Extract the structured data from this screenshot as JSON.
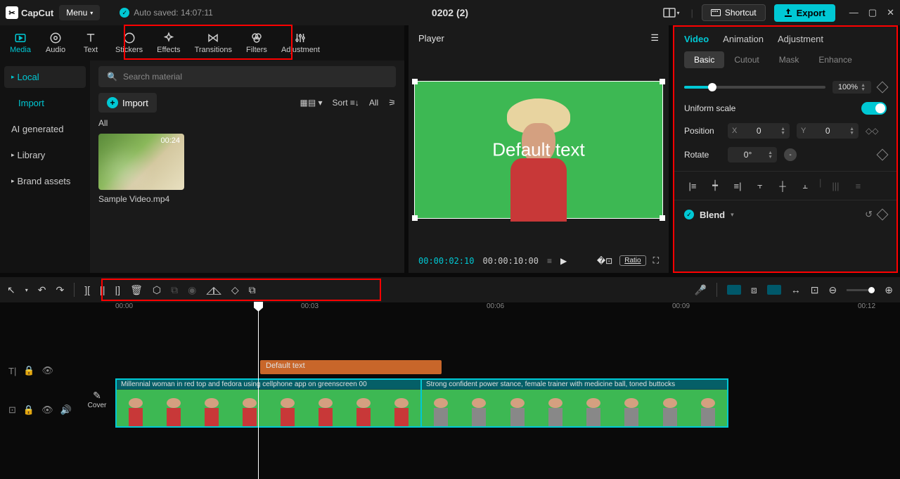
{
  "titlebar": {
    "logo": "CapCut",
    "menu": "Menu",
    "autosave": "Auto saved: 14:07:11",
    "title": "0202 (2)",
    "shortcut": "Shortcut",
    "export": "Export"
  },
  "tabs": {
    "media": "Media",
    "audio": "Audio",
    "text": "Text",
    "stickers": "Stickers",
    "effects": "Effects",
    "transitions": "Transitions",
    "filters": "Filters",
    "adjustment": "Adjustment"
  },
  "sidebar": {
    "local": "Local",
    "import": "Import",
    "ai_generated": "AI generated",
    "library": "Library",
    "brand_assets": "Brand assets"
  },
  "media": {
    "search_placeholder": "Search material",
    "import_btn": "Import",
    "sort": "Sort",
    "all": "All",
    "category": "All",
    "thumb_duration": "00:24",
    "thumb_name": "Sample Video.mp4"
  },
  "player": {
    "header": "Player",
    "overlay_text": "Default text",
    "time_current": "00:00:02:10",
    "time_total": "00:00:10:00",
    "ratio": "Ratio"
  },
  "inspector": {
    "tab_video": "Video",
    "tab_animation": "Animation",
    "tab_adjustment": "Adjustment",
    "sub_basic": "Basic",
    "sub_cutout": "Cutout",
    "sub_mask": "Mask",
    "sub_enhance": "Enhance",
    "scale_value": "100%",
    "uniform_scale": "Uniform scale",
    "position": "Position",
    "pos_x_label": "X",
    "pos_x": "0",
    "pos_y_label": "Y",
    "pos_y": "0",
    "rotate": "Rotate",
    "rotate_value": "0°",
    "blend": "Blend"
  },
  "timeline": {
    "ticks": [
      "00:00",
      "00:03",
      "00:06",
      "00:09",
      "00:12"
    ],
    "cover": "Cover",
    "text_clip": "Default text",
    "clip1_label": "Millennial woman in red top and fedora using cellphone app on greenscreen  00",
    "clip2_label": "Strong confident power stance, female trainer with medicine ball, toned buttocks"
  }
}
